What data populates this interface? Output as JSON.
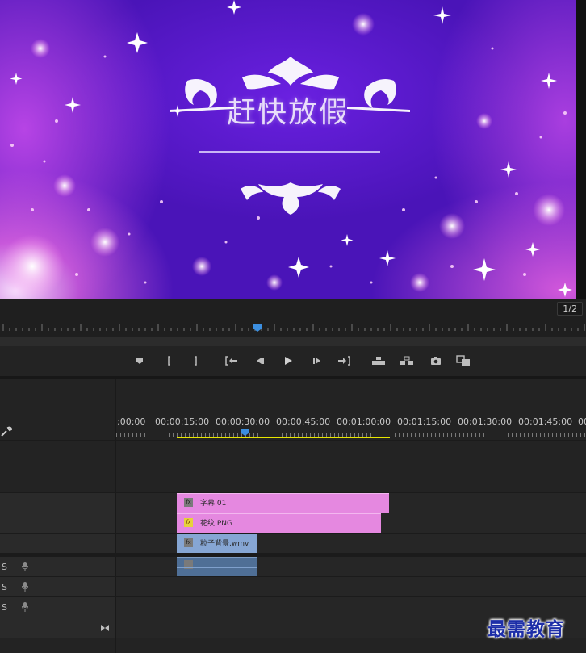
{
  "preview": {
    "title": "赶快放假"
  },
  "monitor": {
    "page_indicator": "1/2"
  },
  "transport": {
    "buttons": [
      {
        "name": "add-marker-button",
        "icon": "marker-icon"
      },
      {
        "name": "mark-in-button",
        "icon": "mark-in-icon"
      },
      {
        "name": "mark-out-button",
        "icon": "mark-out-icon"
      },
      {
        "name": "go-to-in-button",
        "icon": "go-to-in-icon"
      },
      {
        "name": "step-back-button",
        "icon": "step-back-icon"
      },
      {
        "name": "play-button",
        "icon": "play-icon"
      },
      {
        "name": "step-forward-button",
        "icon": "step-forward-icon"
      },
      {
        "name": "go-to-out-button",
        "icon": "go-to-out-icon"
      },
      {
        "name": "lift-button",
        "icon": "lift-icon"
      },
      {
        "name": "extract-button",
        "icon": "extract-icon"
      },
      {
        "name": "export-frame-button",
        "icon": "camera-icon"
      },
      {
        "name": "comparison-view-button",
        "icon": "compare-icon"
      }
    ]
  },
  "timeline": {
    "timecodes": [
      ":00:00",
      "00:00:15:00",
      "00:00:30:00",
      "00:00:45:00",
      "00:01:00:00",
      "00:01:15:00",
      "00:01:30:00",
      "00:01:45:00",
      "00"
    ],
    "clips": {
      "subtitle": {
        "label": "字幕 01",
        "badge": "fx"
      },
      "pattern": {
        "label": "花纹.PNG",
        "badge": "fx"
      },
      "particles": {
        "label": "粒子背景.wmv",
        "badge": "fx"
      }
    },
    "audio_tracks": [
      {
        "label": "S"
      },
      {
        "label": "S"
      },
      {
        "label": "S"
      }
    ]
  },
  "watermark": {
    "text": "最需教育"
  },
  "colors": {
    "playhead": "#3c8fe0",
    "work_area": "#e6e600",
    "title_clip": "#e588e0",
    "video_clip": "#86a6d4",
    "audio_clip": "#4f6f96",
    "watermark": "#1d2ea8"
  }
}
